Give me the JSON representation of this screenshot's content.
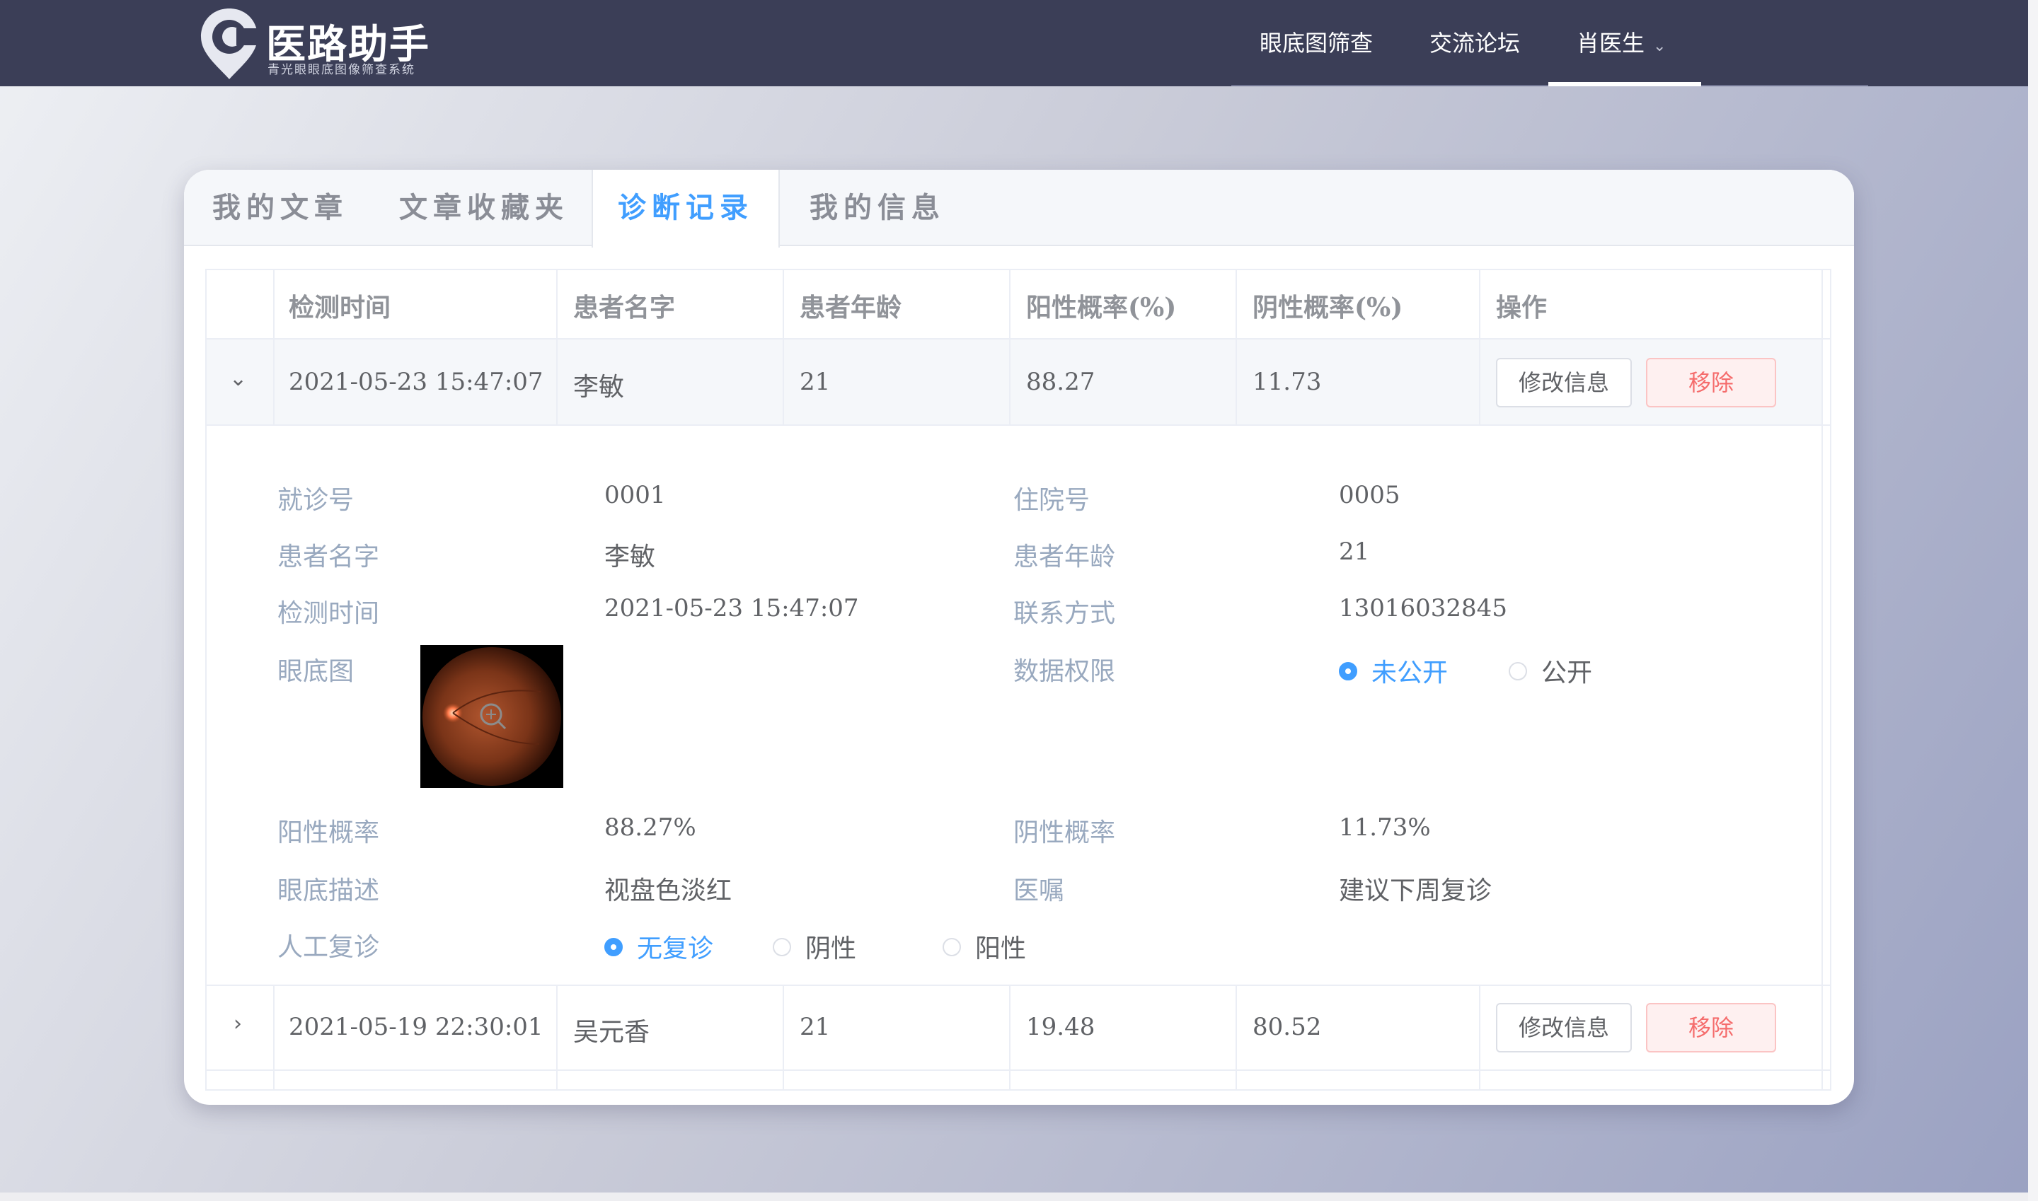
{
  "brand": {
    "title": "医路助手",
    "subtitle": "青光眼眼底图像筛查系统"
  },
  "nav": {
    "items": [
      {
        "label": "眼底图筛查"
      },
      {
        "label": "交流论坛"
      },
      {
        "label": "肖医生"
      }
    ],
    "active_index": 2
  },
  "tabs": [
    {
      "label": "我的文章"
    },
    {
      "label": "文章收藏夹"
    },
    {
      "label": "诊断记录"
    },
    {
      "label": "我的信息"
    }
  ],
  "active_tab": "诊断记录",
  "table": {
    "headers": [
      "检测时间",
      "患者名字",
      "患者年龄",
      "阳性概率(%)",
      "阴性概率(%)",
      "操作"
    ],
    "rows": [
      {
        "time": "2021-05-23 15:47:07",
        "name": "李敏",
        "age": "21",
        "pos": "88.27",
        "neg": "11.73",
        "expanded": true
      },
      {
        "time": "2021-05-19 22:30:01",
        "name": "吴元香",
        "age": "21",
        "pos": "19.48",
        "neg": "80.52",
        "expanded": false
      }
    ],
    "edit_label": "修改信息",
    "remove_label": "移除"
  },
  "detail": {
    "visit_no_label": "就诊号",
    "visit_no": "0001",
    "hosp_no_label": "住院号",
    "hosp_no": "0005",
    "name_label": "患者名字",
    "name": "李敏",
    "age_label": "患者年龄",
    "age": "21",
    "time_label": "检测时间",
    "time": "2021-05-23 15:47:07",
    "contact_label": "联系方式",
    "contact": "13016032845",
    "fundus_label": "眼底图",
    "permission_label": "数据权限",
    "permission_options": [
      "未公开",
      "公开"
    ],
    "permission_selected": "未公开",
    "pos_label": "阳性概率",
    "pos": "88.27%",
    "neg_label": "阴性概率",
    "neg": "11.73%",
    "desc_label": "眼底描述",
    "desc": "视盘色淡红",
    "advice_label": "医嘱",
    "advice": "建议下周复诊",
    "review_label": "人工复诊",
    "review_options": [
      "无复诊",
      "阴性",
      "阳性"
    ],
    "review_selected": "无复诊"
  },
  "colors": {
    "topbar": "#3b3e57",
    "accent": "#409eff",
    "danger": "#f56c6c"
  }
}
